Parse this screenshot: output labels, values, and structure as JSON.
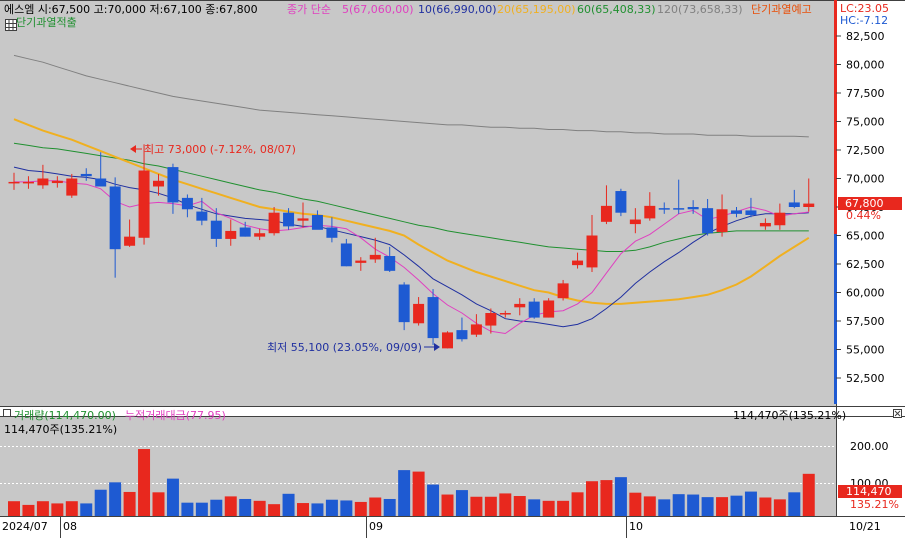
{
  "header": {
    "stock_info": "에스엠 시:67,500 고:70,000 저:67,100 종:67,800",
    "ma_label": "종가 단순",
    "ma5": "5(67,060,00)",
    "ma10": "10(66,990,00)",
    "ma20": "20(65,195,00)",
    "ma60": "60(65,408,33)",
    "ma120": "120(73,658,33)",
    "warning_notice": "단기과열예고",
    "overheat_label": "단기과열적출",
    "lc": "LC:23.05",
    "hc": "HC:-7.12"
  },
  "annotations": {
    "high": "최고 73,000 (-7.12%, 08/07)",
    "low": "최저 55,100 (23.05%, 09/09)"
  },
  "price_axis": {
    "ticks": [
      "82,500",
      "80,000",
      "77,500",
      "75,000",
      "72,500",
      "70,000",
      "67,500",
      "65,000",
      "62,500",
      "60,000",
      "57,500",
      "55,000",
      "52,500"
    ],
    "last_price": "67,800",
    "change_pct": "0.44%"
  },
  "volume_panel": {
    "title_volume": "거래량(114,470.00)",
    "title_cum": "누적거래대금(77.95)",
    "sub_left": "114,470주(135.21%)",
    "sub_right": "114,470주(135.21%)",
    "axis_ticks": [
      "200.00",
      "100.00"
    ],
    "last_label": "114,470",
    "last_pct": "135.21%"
  },
  "date_axis": {
    "labels": [
      "2024/07",
      "08",
      "09",
      "10",
      "10/21"
    ]
  },
  "colors": {
    "up": "#e8281e",
    "down": "#1e5ad2",
    "ma5": "#e040c0",
    "ma10": "#2030a0",
    "ma20": "#f0b020",
    "ma60": "#209030",
    "ma120": "#808080",
    "bg": "#c8c8c8"
  },
  "chart_data": {
    "type": "candlestick",
    "ylim": [
      51000,
      85000
    ],
    "candles": [
      {
        "o": 69700,
        "h": 70500,
        "l": 69000,
        "c": 69700
      },
      {
        "o": 69700,
        "h": 70200,
        "l": 69100,
        "c": 69700
      },
      {
        "o": 69400,
        "h": 71200,
        "l": 69100,
        "c": 70000
      },
      {
        "o": 69600,
        "h": 70200,
        "l": 69200,
        "c": 69800
      },
      {
        "o": 68500,
        "h": 70400,
        "l": 68300,
        "c": 70000
      },
      {
        "o": 70400,
        "h": 70900,
        "l": 69800,
        "c": 70200
      },
      {
        "o": 70000,
        "h": 72300,
        "l": 69600,
        "c": 69300
      },
      {
        "o": 69300,
        "h": 70100,
        "l": 61300,
        "c": 63800
      },
      {
        "o": 64100,
        "h": 66400,
        "l": 64000,
        "c": 64900
      },
      {
        "o": 64800,
        "h": 73000,
        "l": 64200,
        "c": 70700
      },
      {
        "o": 69300,
        "h": 70400,
        "l": 68500,
        "c": 69800
      },
      {
        "o": 71000,
        "h": 71300,
        "l": 66900,
        "c": 67900
      },
      {
        "o": 68300,
        "h": 68600,
        "l": 66600,
        "c": 67300
      },
      {
        "o": 67100,
        "h": 68300,
        "l": 65900,
        "c": 66300
      },
      {
        "o": 66300,
        "h": 67400,
        "l": 64000,
        "c": 64700
      },
      {
        "o": 64700,
        "h": 66400,
        "l": 64100,
        "c": 65400
      },
      {
        "o": 65700,
        "h": 66200,
        "l": 64900,
        "c": 64900
      },
      {
        "o": 64900,
        "h": 65600,
        "l": 64600,
        "c": 65200
      },
      {
        "o": 65200,
        "h": 67500,
        "l": 65000,
        "c": 67000
      },
      {
        "o": 67000,
        "h": 67400,
        "l": 65500,
        "c": 65800
      },
      {
        "o": 66300,
        "h": 67900,
        "l": 65700,
        "c": 66500
      },
      {
        "o": 66800,
        "h": 67200,
        "l": 65600,
        "c": 65500
      },
      {
        "o": 65700,
        "h": 66600,
        "l": 64400,
        "c": 64800
      },
      {
        "o": 64300,
        "h": 64700,
        "l": 62300,
        "c": 62300
      },
      {
        "o": 62600,
        "h": 63100,
        "l": 61900,
        "c": 62800
      },
      {
        "o": 62900,
        "h": 64800,
        "l": 62600,
        "c": 63300
      },
      {
        "o": 63200,
        "h": 64000,
        "l": 61800,
        "c": 61900
      },
      {
        "o": 60700,
        "h": 60900,
        "l": 56700,
        "c": 57400
      },
      {
        "o": 57300,
        "h": 59600,
        "l": 57100,
        "c": 59000
      },
      {
        "o": 59600,
        "h": 60300,
        "l": 55400,
        "c": 56000
      },
      {
        "o": 55100,
        "h": 56600,
        "l": 55100,
        "c": 56500
      },
      {
        "o": 56700,
        "h": 57800,
        "l": 55700,
        "c": 55900
      },
      {
        "o": 56300,
        "h": 58100,
        "l": 56100,
        "c": 57200
      },
      {
        "o": 57100,
        "h": 58600,
        "l": 56400,
        "c": 58200
      },
      {
        "o": 58200,
        "h": 58400,
        "l": 57800,
        "c": 58200
      },
      {
        "o": 58700,
        "h": 59500,
        "l": 58000,
        "c": 59000
      },
      {
        "o": 59200,
        "h": 59500,
        "l": 57700,
        "c": 57800
      },
      {
        "o": 57800,
        "h": 59500,
        "l": 57800,
        "c": 59300
      },
      {
        "o": 59500,
        "h": 61100,
        "l": 59300,
        "c": 60800
      },
      {
        "o": 62400,
        "h": 63500,
        "l": 62100,
        "c": 62800
      },
      {
        "o": 62200,
        "h": 66800,
        "l": 61800,
        "c": 65000
      },
      {
        "o": 66200,
        "h": 69400,
        "l": 66000,
        "c": 67600
      },
      {
        "o": 68900,
        "h": 69100,
        "l": 66700,
        "c": 67000
      },
      {
        "o": 66000,
        "h": 67400,
        "l": 65200,
        "c": 66400
      },
      {
        "o": 66500,
        "h": 68800,
        "l": 66300,
        "c": 67600
      },
      {
        "o": 67400,
        "h": 67900,
        "l": 66900,
        "c": 67300
      },
      {
        "o": 67400,
        "h": 69900,
        "l": 66900,
        "c": 67300
      },
      {
        "o": 67500,
        "h": 68100,
        "l": 66900,
        "c": 67300
      },
      {
        "o": 67400,
        "h": 68200,
        "l": 65000,
        "c": 65200
      },
      {
        "o": 65300,
        "h": 68600,
        "l": 64900,
        "c": 67300
      },
      {
        "o": 67200,
        "h": 67500,
        "l": 66600,
        "c": 66900
      },
      {
        "o": 67200,
        "h": 68300,
        "l": 66600,
        "c": 66800
      },
      {
        "o": 65800,
        "h": 66500,
        "l": 65500,
        "c": 66100
      },
      {
        "o": 65900,
        "h": 67800,
        "l": 65500,
        "c": 67000
      },
      {
        "o": 67900,
        "h": 69000,
        "l": 67400,
        "c": 67500
      },
      {
        "o": 67500,
        "h": 70000,
        "l": 67100,
        "c": 67800
      }
    ],
    "volumes": [
      40,
      30,
      40,
      34,
      40,
      34,
      71,
      91,
      65,
      181,
      64,
      101,
      36,
      36,
      44,
      53,
      46,
      41,
      32,
      60,
      35,
      34,
      44,
      42,
      38,
      50,
      46,
      124,
      120,
      85,
      58,
      70,
      52,
      52,
      61,
      54,
      45,
      41,
      41,
      64,
      94,
      97,
      105,
      63,
      53,
      45,
      59,
      58,
      51,
      51,
      55,
      66,
      50,
      45,
      64,
      114
    ],
    "ma120": [
      80800,
      80500,
      80200,
      79800,
      79400,
      79000,
      78700,
      78400,
      78100,
      77800,
      77500,
      77200,
      77000,
      76800,
      76600,
      76400,
      76200,
      76000,
      75900,
      75800,
      75700,
      75600,
      75500,
      75400,
      75300,
      75200,
      75100,
      75000,
      74900,
      74800,
      74700,
      74700,
      74600,
      74500,
      74500,
      74400,
      74400,
      74300,
      74300,
      74200,
      74200,
      74100,
      74100,
      74000,
      74000,
      73900,
      73900,
      73900,
      73800,
      73800,
      73800,
      73700,
      73700,
      73700,
      73700,
      73650
    ],
    "ma60": [
      73100,
      72900,
      72700,
      72600,
      72400,
      72200,
      72000,
      71800,
      71600,
      71300,
      71100,
      70800,
      70500,
      70200,
      69900,
      69600,
      69300,
      69000,
      68800,
      68500,
      68200,
      68000,
      67700,
      67400,
      67100,
      66800,
      66500,
      66200,
      65900,
      65700,
      65400,
      65200,
      65000,
      64800,
      64600,
      64400,
      64200,
      64000,
      63900,
      63800,
      63700,
      63600,
      63600,
      63700,
      64000,
      64400,
      64700,
      65000,
      65200,
      65300,
      65400,
      65400,
      65400,
      65400,
      65400,
      65400
    ],
    "ma20": [
      75200,
      74700,
      74200,
      73800,
      73400,
      72900,
      72400,
      71900,
      71400,
      70900,
      70400,
      69900,
      69500,
      69100,
      68700,
      68300,
      67900,
      67500,
      67300,
      67100,
      66900,
      66800,
      66600,
      66300,
      66000,
      65700,
      65400,
      65000,
      64200,
      63500,
      62800,
      62300,
      61800,
      61400,
      61000,
      60600,
      60200,
      60000,
      59600,
      59300,
      59100,
      59000,
      59000,
      59100,
      59200,
      59300,
      59400,
      59600,
      59800,
      60200,
      60700,
      61400,
      62300,
      63200,
      64000,
      64800
    ],
    "ma10": [
      71000,
      70700,
      70600,
      70400,
      70200,
      70100,
      69900,
      69500,
      69200,
      69000,
      68700,
      68300,
      67700,
      67300,
      66900,
      66700,
      66500,
      66400,
      66300,
      66000,
      65800,
      65800,
      65500,
      65200,
      64900,
      64600,
      64200,
      63300,
      62300,
      61200,
      60500,
      59800,
      59000,
      58400,
      57700,
      57500,
      57400,
      57200,
      57000,
      57200,
      57700,
      58600,
      59600,
      60800,
      61800,
      62700,
      63500,
      64400,
      65200,
      65800,
      66300,
      66700,
      66900,
      66900,
      66900,
      66990
    ],
    "ma5": [
      69700,
      69700,
      69800,
      69800,
      69600,
      69500,
      69100,
      68000,
      67500,
      67800,
      67900,
      67800,
      67600,
      68000,
      67000,
      66500,
      65900,
      65600,
      65400,
      65500,
      65700,
      65900,
      65800,
      65600,
      64800,
      63800,
      63100,
      62200,
      61100,
      59900,
      58900,
      58200,
      57300,
      56600,
      56400,
      57300,
      58000,
      58300,
      58400,
      59000,
      60000,
      61700,
      63400,
      64500,
      65100,
      66000,
      66900,
      67200,
      66400,
      66700,
      67100,
      67500,
      67200,
      66700,
      66900,
      67060
    ]
  }
}
